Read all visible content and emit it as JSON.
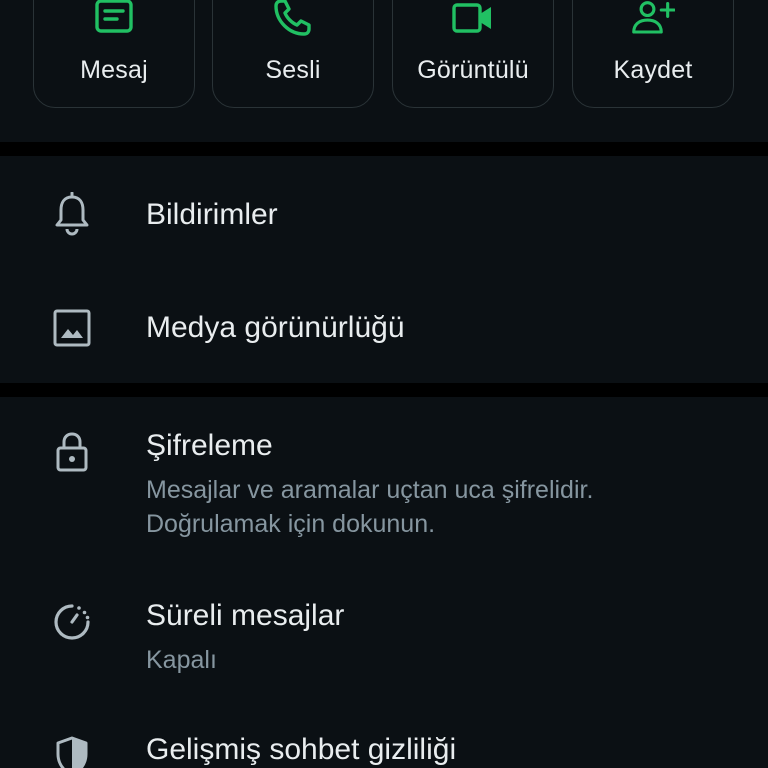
{
  "actions": {
    "message_label": "Mesaj",
    "voice_label": "Sesli",
    "video_label": "Görüntülü",
    "save_label": "Kaydet"
  },
  "settings": {
    "notifications_title": "Bildirimler",
    "media_visibility_title": "Medya görünürlüğü",
    "encryption_title": "Şifreleme",
    "encryption_sub_line1": "Mesajlar ve aramalar uçtan uca şifrelidir.",
    "encryption_sub_line2": "Doğrulamak için dokunun.",
    "disappearing_title": "Süreli mesajlar",
    "disappearing_sub": "Kapalı",
    "advanced_privacy_title": "Gelişmiş sohbet gizliliği"
  },
  "colors": {
    "accent": "#21c063",
    "background": "#0b1014",
    "divider": "#000000",
    "primary_text": "#e9edef",
    "secondary_text": "#8696a0",
    "icon_gray": "#aebac1"
  },
  "icons": {
    "message": "message-icon",
    "voice": "phone-icon",
    "video": "video-camera-icon",
    "save": "add-person-icon",
    "notifications": "bell-icon",
    "media": "image-icon",
    "encryption": "lock-icon",
    "disappearing": "timer-icon",
    "advanced_privacy": "shield-icon"
  }
}
